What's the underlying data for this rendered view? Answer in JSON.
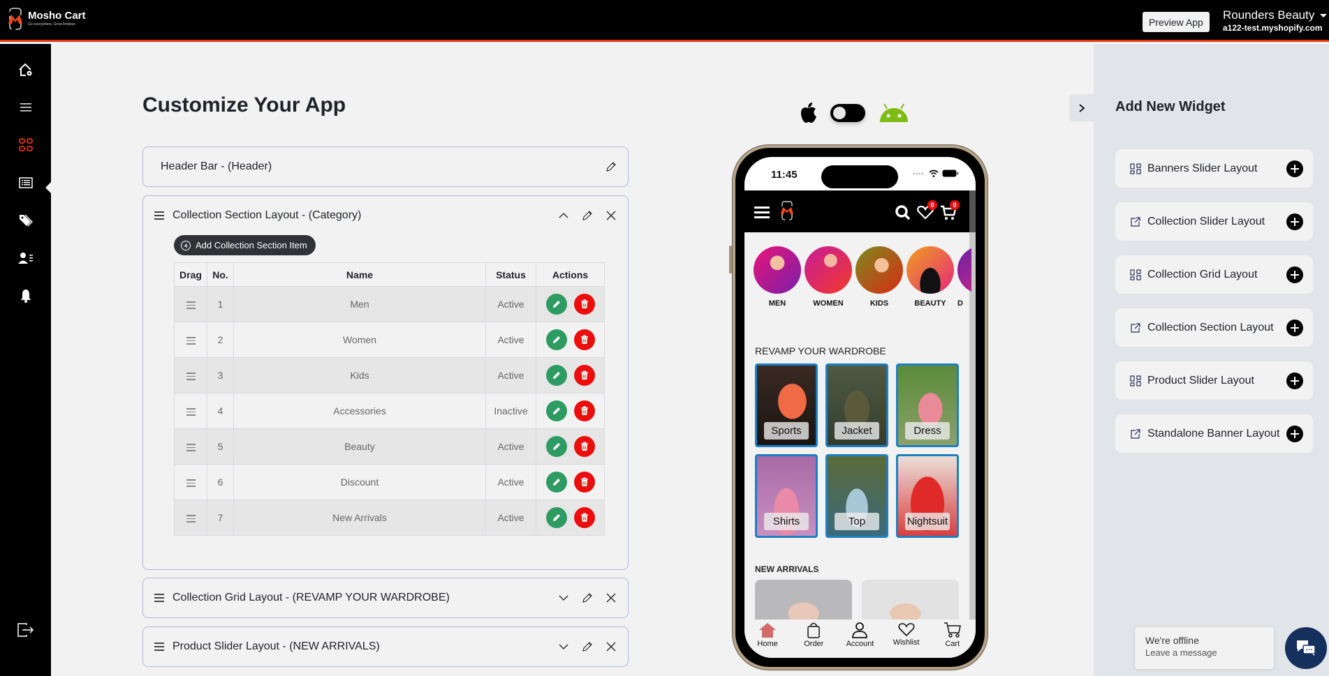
{
  "topbar": {
    "brand_name": "Mosho Cart",
    "brand_tagline": "Go everywhere, Grow limitless",
    "preview_label": "Preview App",
    "store_name": "Rounders Beauty",
    "store_domain": "a122-test.myshopify.com"
  },
  "sidebar": {
    "items": [
      {
        "icon": "home-settings-icon",
        "label": "Home"
      },
      {
        "icon": "menu-icon",
        "label": "Menu"
      },
      {
        "icon": "grid-icon",
        "label": "Customize",
        "active": true
      },
      {
        "icon": "list-icon",
        "label": "Pages"
      },
      {
        "icon": "tags-icon",
        "label": "Tags"
      },
      {
        "icon": "user-list-icon",
        "label": "Users"
      },
      {
        "icon": "bell-icon",
        "label": "Notifications"
      }
    ],
    "logout_icon": "logout-icon",
    "active_color": "#e8340f"
  },
  "main": {
    "title": "Customize Your App",
    "sections": [
      {
        "title": "Header Bar - (Header)",
        "expanded": false,
        "draggable": false
      },
      {
        "title": "Collection Section Layout - (Category)",
        "expanded": true,
        "draggable": true
      },
      {
        "title": "Collection Grid Layout - (REVAMP YOUR WARDROBE)",
        "expanded": false,
        "draggable": true
      },
      {
        "title": "Product Slider Layout - (NEW ARRIVALS)",
        "expanded": false,
        "draggable": true
      }
    ],
    "add_item_label": "Add Collection Section Item",
    "table": {
      "headers": [
        "Drag",
        "No.",
        "Name",
        "Status",
        "Actions"
      ],
      "rows": [
        {
          "no": "1",
          "name": "Men",
          "status": "Active"
        },
        {
          "no": "2",
          "name": "Women",
          "status": "Active"
        },
        {
          "no": "3",
          "name": "Kids",
          "status": "Active"
        },
        {
          "no": "4",
          "name": "Accessories",
          "status": "Inactive"
        },
        {
          "no": "5",
          "name": "Beauty",
          "status": "Active"
        },
        {
          "no": "6",
          "name": "Discount",
          "status": "Active"
        },
        {
          "no": "7",
          "name": "New Arrivals",
          "status": "Active"
        }
      ]
    },
    "colors": {
      "edit": "#2e9c62",
      "delete": "#ec0d0d"
    }
  },
  "os_toggle": {
    "left": "apple-icon",
    "right": "android-icon",
    "android_color": "#7cbc13"
  },
  "phone": {
    "time": "11:45",
    "wishlist_count": "0",
    "cart_count": "0",
    "categories": [
      "MEN",
      "WOMEN",
      "KIDS",
      "BEAUTY",
      "D"
    ],
    "grid_title": "REVAMP YOUR WARDROBE",
    "grid_tiles": [
      "Sports",
      "Jacket",
      "Dress",
      "Shirts",
      "Top",
      "Nightsuit"
    ],
    "new_arrivals_title": "NEW ARRIVALS",
    "bottom_nav": [
      "Home",
      "Order",
      "Account",
      "Wishlist",
      "Cart"
    ]
  },
  "right_panel": {
    "title": "Add New Widget",
    "widgets": [
      {
        "label": "Banners Slider Layout",
        "icon": "layout-grid-icon"
      },
      {
        "label": "Collection Slider Layout",
        "icon": "external-link-icon"
      },
      {
        "label": "Collection Grid Layout",
        "icon": "layout-grid-icon"
      },
      {
        "label": "Collection Section Layout",
        "icon": "external-link-icon"
      },
      {
        "label": "Product Slider Layout",
        "icon": "layout-grid-icon"
      },
      {
        "label": "Standalone Banner Layout",
        "icon": "external-link-icon"
      }
    ]
  },
  "chat": {
    "title": "We're offline",
    "subtitle": "Leave a message",
    "color": "#15305c"
  }
}
